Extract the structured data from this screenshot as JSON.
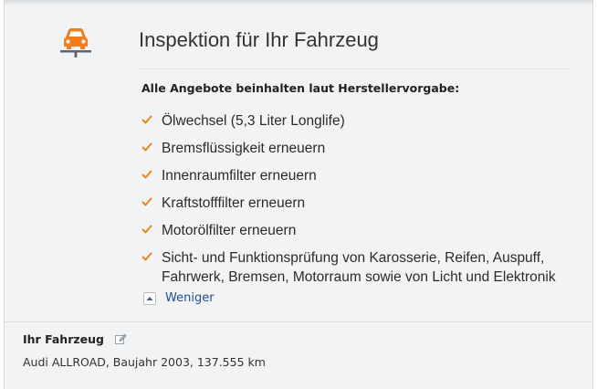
{
  "header": {
    "title": "Inspektion für Ihr Fahrzeug",
    "icon": "car-on-lift-icon",
    "accent_color": "#f07d1e"
  },
  "services": {
    "intro": "Alle Angebote beinhalten laut Herstellervorgabe:",
    "check_icon": "checkmark-icon",
    "check_color": "#e8871e",
    "items": [
      {
        "label": "Ölwechsel (5,3 Liter Longlife)"
      },
      {
        "label": "Bremsflüssigkeit erneuern"
      },
      {
        "label": "Innenraumfilter erneuern"
      },
      {
        "label": "Kraftstofffilter erneuern"
      },
      {
        "label": "Motorölfilter erneuern"
      },
      {
        "label_line1": "Sicht- und Funktionsprüfung von Karosserie, Reifen, Auspuff,",
        "label_line2": "Fahrwerk, Bremsen, Motorraum sowie von Licht und Elektronik"
      }
    ],
    "toggle_label": "Weniger",
    "toggle_icon": "chevron-up-icon"
  },
  "vehicle": {
    "heading": "Ihr Fahrzeug",
    "edit_icon": "pencil-edit-icon",
    "details": "Audi ALLROAD, Baujahr 2003, 137.555 km"
  }
}
